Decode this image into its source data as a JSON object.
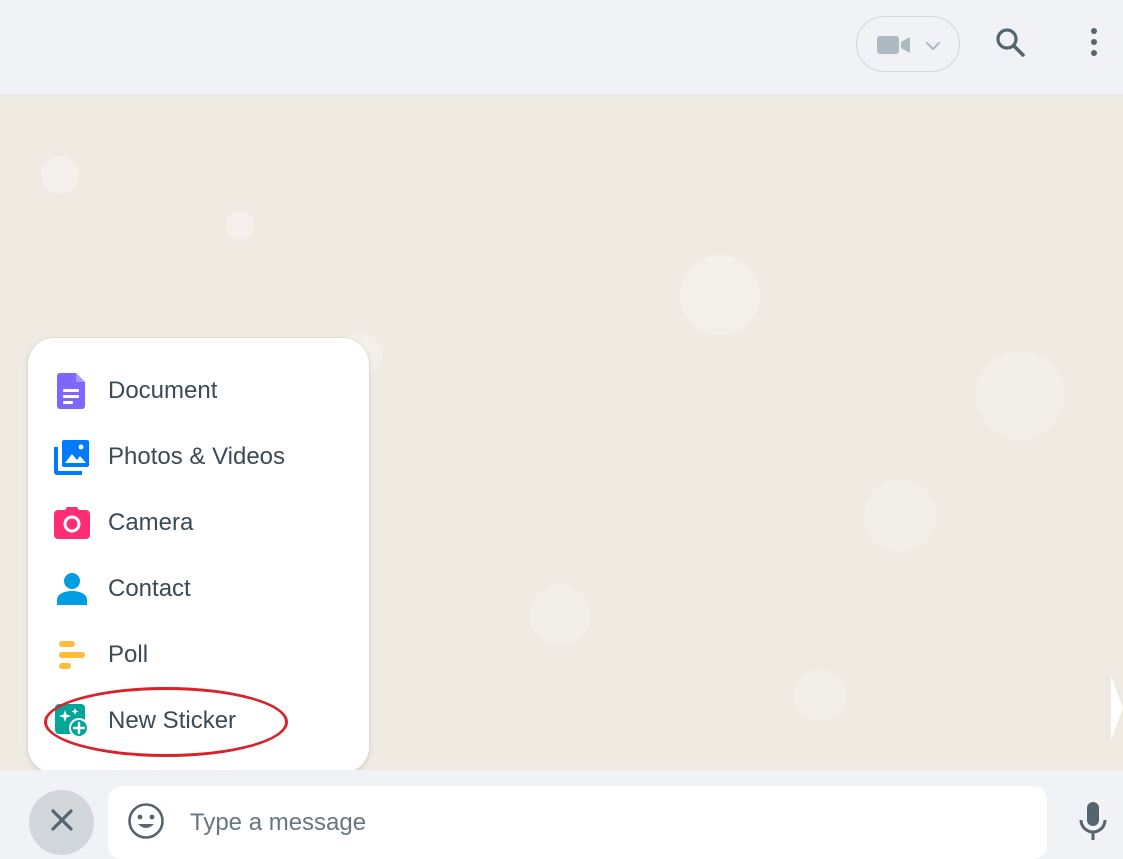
{
  "header": {
    "video_call_icon": "video-camera-icon",
    "video_dropdown_icon": "chevron-down-icon",
    "search_icon": "search-icon",
    "menu_icon": "more-vertical-icon"
  },
  "attach_menu": {
    "items": [
      {
        "label": "Document",
        "icon": "document-icon",
        "color": "#7f66ff"
      },
      {
        "label": "Photos & Videos",
        "icon": "photos-videos-icon",
        "color": "#007bfc"
      },
      {
        "label": "Camera",
        "icon": "camera-icon",
        "color": "#ff2e74"
      },
      {
        "label": "Contact",
        "icon": "contact-icon",
        "color": "#009de2"
      },
      {
        "label": "Poll",
        "icon": "poll-icon",
        "color": "#ffbc38"
      },
      {
        "label": "New Sticker",
        "icon": "new-sticker-icon",
        "color": "#02a698"
      }
    ],
    "highlighted_item": "New Sticker",
    "highlight_color": "#d8232a"
  },
  "composer": {
    "placeholder": "Type a message",
    "value": "",
    "close_icon": "close-icon",
    "emoji_icon": "emoji-icon",
    "mic_icon": "microphone-icon"
  },
  "colors": {
    "header_bg": "#f0f2f5",
    "chat_bg": "#efeae2",
    "icon_gray": "#54656f"
  }
}
